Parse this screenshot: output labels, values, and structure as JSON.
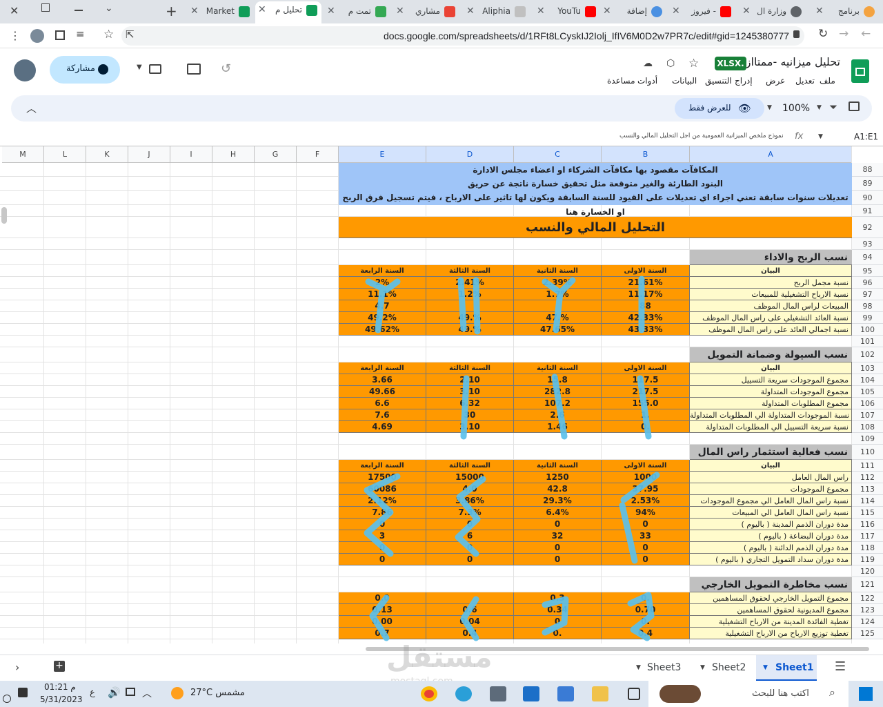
{
  "browser": {
    "tabs": [
      {
        "title": "برنامج",
        "icon": "orange-circle-icon"
      },
      {
        "title": "وزارة ال",
        "icon": "globe-icon"
      },
      {
        "title": "فيروز -",
        "icon": "youtube-icon"
      },
      {
        "title": "إضافة",
        "icon": "blue-circle-icon"
      },
      {
        "title": "YouTu",
        "icon": "youtube-icon"
      },
      {
        "title": "Aliphia",
        "icon": "doc-icon"
      },
      {
        "title": "مشاري",
        "icon": "gmail-icon"
      },
      {
        "title": "تمت م",
        "icon": "drive-icon"
      },
      {
        "title": "تحليل م",
        "icon": "sheets-icon"
      },
      {
        "title": "Market",
        "icon": "sheets-icon"
      }
    ],
    "url": "docs.google.com/spreadsheets/d/1RFt8LCyskIJ2Iolj_IfIV6M0D2w7PR7c/edit#gid=1245380777"
  },
  "docs": {
    "title": "تحليل ميزانيه -ممتااز",
    "badge": "XLSX.",
    "share_label": "مشاركة",
    "menu": [
      "ملف",
      "تعديل",
      "عرض",
      "إدراج",
      "التنسيق",
      "البيانات",
      "أدوات",
      "مساعدة"
    ],
    "view_only": "للعرض فقط",
    "zoom": "100%"
  },
  "formula": {
    "cell_ref": "A1:E1",
    "fx": "fx",
    "content": "نموذج ملخص الميزانية العمومية من اجل التحليل المالي والنسب"
  },
  "columns": [
    "A",
    "B",
    "C",
    "D",
    "E",
    "F",
    "G",
    "H",
    "I",
    "J",
    "K",
    "L",
    "M"
  ],
  "rows": [
    "88",
    "89",
    "90",
    "91",
    "92",
    "93",
    "94",
    "95",
    "96",
    "97",
    "98",
    "99",
    "100",
    "101",
    "102",
    "103",
    "104",
    "105",
    "106",
    "107",
    "108",
    "109",
    "110",
    "111",
    "112",
    "113",
    "114",
    "115",
    "116",
    "117",
    "118",
    "119",
    "120",
    "121",
    "122",
    "123",
    "124",
    "125"
  ],
  "notes": [
    "المكافآت مقصود بها مكافآت الشركاء او  اعضاء مجلس الادارة",
    "البنود الطارئة والغير متوقعة مثل تحقيق خسارة ناتجة عن حريق",
    "تعديلات سنوات سابقة تعني اجراء اي تعديلات على القيود للسنة السابقة ويكون لها تاثير على الارباح ، فيتم تسجيل فرق الربح او الخسارة هنا"
  ],
  "main_title": "التحليل المالي والنسب",
  "year_headers": [
    "البيان",
    "السنة الاولى",
    "السنة الثانية",
    "السنة الثالثة",
    "السنة الرابعة"
  ],
  "sections": [
    {
      "title": "نسب الربح والاداء",
      "rows": [
        {
          "label": "نسبة مجمل الربح",
          "values": [
            "21.61%",
            "2.39%",
            "2.41%",
            "2%"
          ]
        },
        {
          "label": "نسبة الارباح التشغيلية للمبيعات",
          "values": [
            "11.17%",
            "1.7%",
            "1.2%",
            "11.1%"
          ]
        },
        {
          "label": "المبيعات لراس المال الموظف",
          "values": [
            "88",
            "",
            "",
            "4.7"
          ]
        },
        {
          "label": "نسبة العائد التشغيلي على راس المال الموظف",
          "values": [
            "42.33%",
            "47.%",
            "49.%",
            "49.2%"
          ]
        },
        {
          "label": "نسبة اجمالي العائد على راس المال الموظف",
          "values": [
            "43.33%",
            "47.65%",
            "49.%",
            "49.62%"
          ]
        }
      ]
    },
    {
      "title": "نسب السيولة وضمانة التمويل",
      "rows": [
        {
          "label": "مجموع الموجودات سريعة التسييل",
          "values": [
            "117.5",
            "15.8",
            "2.10",
            "3.66"
          ]
        },
        {
          "label": "مجموع الموجودات المتداولة",
          "values": [
            "217.5",
            "282.8",
            "3.10",
            "49.66"
          ]
        },
        {
          "label": "مجموع المطلوبات المتداولة",
          "values": [
            "155.0",
            "107.2",
            "6.32",
            "6.6"
          ]
        },
        {
          "label": "نسبة الموجودات المتداولة الي المطلوبات المتداولة",
          "values": [
            "1.",
            "2.6",
            "30",
            "7.6"
          ]
        },
        {
          "label": "نسبة سريعة التسييل الي المطلوبات المتداولة",
          "values": [
            "0.",
            "1.46",
            "3.10",
            "4.69"
          ]
        }
      ]
    },
    {
      "title": "نسب فعالية استثمار راس المال العامل",
      "rows": [
        {
          "label": "راس المال العامل",
          "values": [
            "1000",
            "1250",
            "15000",
            "17500"
          ]
        },
        {
          "label": "مجموع الموجودات",
          "values": [
            "37.95",
            "42.8",
            "4.0",
            "60086"
          ]
        },
        {
          "label": "نسبة راس المال العامل الي مجموع الموجودات",
          "values": [
            "2.53%",
            "29.3%",
            "3.86%",
            "2.12%"
          ]
        },
        {
          "label": "نسبة راس المال العامل الي المبيعات",
          "values": [
            "94%",
            "6.4%",
            "7.3%",
            "7.86"
          ]
        },
        {
          "label": "مدة دوران الذمم المدينة ( باليوم )",
          "values": [
            "0",
            "0",
            "0",
            "0"
          ]
        },
        {
          "label": "مدة دوران البضاعة ( باليوم )",
          "values": [
            "33",
            "32",
            "6",
            "3"
          ]
        },
        {
          "label": "مدة دوران الذمم الدائنة ( باليوم )",
          "values": [
            "0",
            "0",
            "0",
            "0"
          ]
        },
        {
          "label": "مدة دوران سداد التمويل التجاري ( باليوم )",
          "values": [
            "0",
            "0",
            "0",
            "0"
          ]
        }
      ]
    },
    {
      "title": "نسب مخاطرة التمويل الخارجي",
      "rows": [
        {
          "label": "مجموع التمويل الخارجي لحقوق المساهمين",
          "values": [
            "0.",
            "0.3",
            "",
            "0.0"
          ]
        },
        {
          "label": "مجموع المديونية لحقوق المساهمين",
          "values": [
            "0.70",
            "0.34",
            "0.6",
            "0.13"
          ]
        },
        {
          "label": "تغطية الفائدة المدينة من الارباح التشغيلية",
          "values": [
            "0.",
            "0",
            "0.04",
            "0.00"
          ]
        },
        {
          "label": "تغطية توزيع الارباح من الارباح التشغيلية",
          "values": [
            "0.4",
            "0.",
            "0.4",
            "0.7"
          ]
        }
      ]
    }
  ],
  "sheets": [
    "Sheet1",
    "Sheet2",
    "Sheet3"
  ],
  "taskbar": {
    "search": "اكتب هنا للبحث",
    "weather": "27°C  مشمس",
    "time": "01:21 م",
    "date": "5/31/2023",
    "lang": "ع",
    "watermark": "مستقل",
    "watermark_sub": "mostaql.com"
  },
  "colors": {
    "orange": "#ff9900",
    "label_bg": "#fffbcc",
    "note_bg": "#9fc5f8",
    "section_bg": "#c0c0c0",
    "title_bg": "#ff9900"
  }
}
